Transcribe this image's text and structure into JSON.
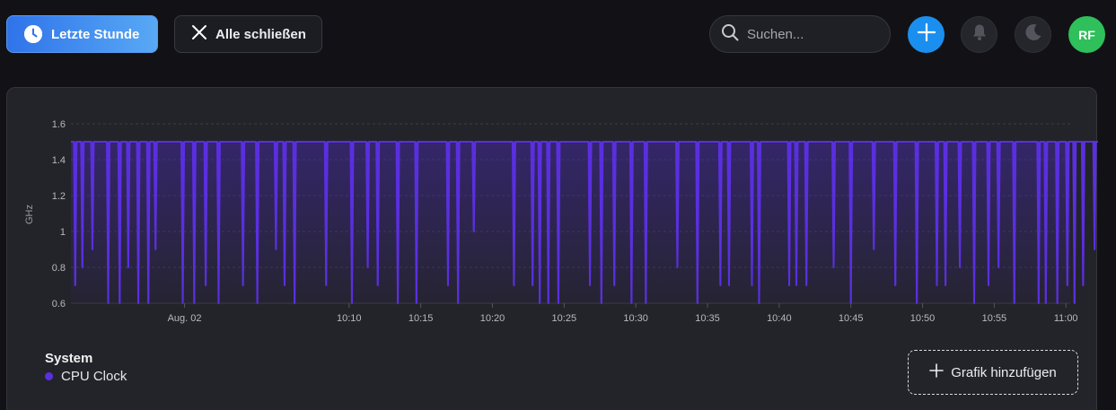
{
  "toolbar": {
    "time_range_label": "Letzte Stunde",
    "close_all_label": "Alle schließen",
    "search_placeholder": "Suchen...",
    "avatar_initials": "RF"
  },
  "panel": {
    "group_label": "System",
    "series_label": "CPU Clock",
    "add_chart_label": "Grafik hinzufügen"
  },
  "colors": {
    "accent": "#1b8ff0",
    "series": "#5a2fe0",
    "avatar": "#2fbf5b"
  },
  "icons": {
    "time_range": "clock-icon",
    "close_all": "close-icon",
    "search": "search-icon",
    "add": "plus-icon",
    "notifications": "bell-icon",
    "theme": "moon-icon",
    "add_chart": "plus-icon"
  },
  "chart_data": {
    "type": "area",
    "ylabel": "GHz",
    "ylim": [
      0.6,
      1.6
    ],
    "yticks": [
      "0.6",
      "0.8",
      "1",
      "1.2",
      "1.4",
      "1.6"
    ],
    "xticks": [
      "Aug. 02",
      "10:10",
      "10:15",
      "10:20",
      "10:25",
      "10:30",
      "10:35",
      "10:40",
      "10:45",
      "10:50",
      "10:55",
      "11:00"
    ],
    "xrange_minutes": [
      -9.4,
      60.3
    ],
    "grid": true,
    "series": [
      {
        "name": "CPU Clock",
        "baseline": 1.5,
        "dips": [
          {
            "t": -9.1,
            "v": 0.7
          },
          {
            "t": -8.6,
            "v": 0.8
          },
          {
            "t": -7.9,
            "v": 0.9
          },
          {
            "t": -6.8,
            "v": 0.6
          },
          {
            "t": -6.0,
            "v": 0.6
          },
          {
            "t": -5.4,
            "v": 0.8
          },
          {
            "t": -4.7,
            "v": 0.6
          },
          {
            "t": -4.0,
            "v": 0.6
          },
          {
            "t": -3.5,
            "v": 0.9
          },
          {
            "t": -1.6,
            "v": 0.6
          },
          {
            "t": -0.8,
            "v": 0.6
          },
          {
            "t": 0.0,
            "v": 0.7
          },
          {
            "t": 0.9,
            "v": 0.6
          },
          {
            "t": 2.6,
            "v": 0.7
          },
          {
            "t": 3.6,
            "v": 0.6
          },
          {
            "t": 4.9,
            "v": 0.9
          },
          {
            "t": 5.5,
            "v": 0.7
          },
          {
            "t": 6.2,
            "v": 0.6
          },
          {
            "t": 8.4,
            "v": 0.7
          },
          {
            "t": 10.2,
            "v": 0.6
          },
          {
            "t": 11.3,
            "v": 0.8
          },
          {
            "t": 12.0,
            "v": 0.7
          },
          {
            "t": 13.4,
            "v": 0.6
          },
          {
            "t": 14.7,
            "v": 0.6
          },
          {
            "t": 16.9,
            "v": 0.7
          },
          {
            "t": 17.6,
            "v": 0.6
          },
          {
            "t": 18.7,
            "v": 1.0
          },
          {
            "t": 21.5,
            "v": 0.7
          },
          {
            "t": 22.8,
            "v": 0.7
          },
          {
            "t": 23.3,
            "v": 0.6
          },
          {
            "t": 23.9,
            "v": 0.6
          },
          {
            "t": 24.6,
            "v": 0.6
          },
          {
            "t": 26.8,
            "v": 0.7
          },
          {
            "t": 27.6,
            "v": 0.6
          },
          {
            "t": 28.5,
            "v": 0.7
          },
          {
            "t": 29.7,
            "v": 0.6
          },
          {
            "t": 30.7,
            "v": 0.6
          },
          {
            "t": 32.9,
            "v": 0.8
          },
          {
            "t": 34.3,
            "v": 0.6
          },
          {
            "t": 35.9,
            "v": 0.7
          },
          {
            "t": 36.5,
            "v": 0.7
          },
          {
            "t": 38.1,
            "v": 0.7
          },
          {
            "t": 38.6,
            "v": 0.6
          },
          {
            "t": 40.7,
            "v": 0.7
          },
          {
            "t": 41.2,
            "v": 0.7
          },
          {
            "t": 41.9,
            "v": 0.7
          },
          {
            "t": 43.8,
            "v": 0.8
          },
          {
            "t": 45.0,
            "v": 0.6
          },
          {
            "t": 46.6,
            "v": 0.9
          },
          {
            "t": 48.1,
            "v": 0.7
          },
          {
            "t": 49.6,
            "v": 0.6
          },
          {
            "t": 51.0,
            "v": 0.7
          },
          {
            "t": 51.6,
            "v": 0.7
          },
          {
            "t": 52.6,
            "v": 0.8
          },
          {
            "t": 53.6,
            "v": 0.6
          },
          {
            "t": 54.6,
            "v": 0.7
          },
          {
            "t": 55.3,
            "v": 0.8
          },
          {
            "t": 56.4,
            "v": 0.6
          },
          {
            "t": 58.1,
            "v": 0.6
          },
          {
            "t": 58.6,
            "v": 0.6
          },
          {
            "t": 59.4,
            "v": 0.6
          },
          {
            "t": 60.1,
            "v": 0.7
          },
          {
            "t": 60.6,
            "v": 0.6
          },
          {
            "t": 61.2,
            "v": 0.7
          },
          {
            "t": 62.0,
            "v": 0.9
          },
          {
            "t": 63.3,
            "v": 0.6
          },
          {
            "t": 63.9,
            "v": 0.8
          },
          {
            "t": 64.6,
            "v": 0.6
          },
          {
            "t": 65.4,
            "v": 0.6
          },
          {
            "t": 66.6,
            "v": 0.9
          },
          {
            "t": 67.2,
            "v": 0.8
          },
          {
            "t": 68.0,
            "v": 0.6
          },
          {
            "t": 68.6,
            "v": 0.7
          },
          {
            "t": 69.0,
            "v": 0.9
          }
        ]
      }
    ]
  }
}
